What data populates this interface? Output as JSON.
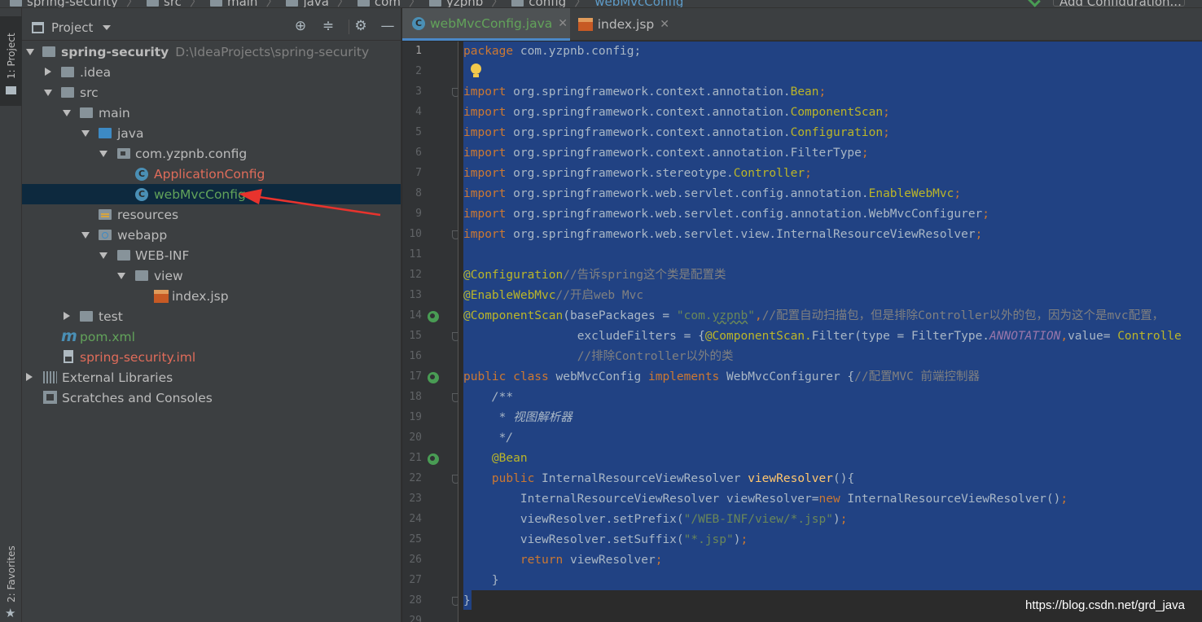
{
  "navbar": {
    "crumbs": [
      "spring-security",
      "src",
      "main",
      "java",
      "com",
      "yzpnb",
      "config"
    ],
    "current": "webMvcConfig",
    "run_config_label": "Add Configuration..."
  },
  "left_strip": {
    "project_label": "1: Project",
    "favorites_label": "2: Favorites"
  },
  "project_panel": {
    "title": "Project",
    "tree": [
      {
        "label": "spring-security",
        "path": "D:\\IdeaProjects\\spring-security"
      },
      {
        "label": ".idea"
      },
      {
        "label": "src"
      },
      {
        "label": "main"
      },
      {
        "label": "java"
      },
      {
        "label": "com.yzpnb.config"
      },
      {
        "label": "ApplicationConfig"
      },
      {
        "label": "webMvcConfig"
      },
      {
        "label": "resources"
      },
      {
        "label": "webapp"
      },
      {
        "label": "WEB-INF"
      },
      {
        "label": "view"
      },
      {
        "label": "index.jsp"
      },
      {
        "label": "test"
      },
      {
        "label": "pom.xml"
      },
      {
        "label": "spring-security.iml"
      },
      {
        "label": "External Libraries"
      },
      {
        "label": "Scratches and Consoles"
      }
    ]
  },
  "editor": {
    "tabs": [
      {
        "label": "webMvcConfig.java",
        "active": true
      },
      {
        "label": "index.jsp",
        "active": false
      }
    ],
    "line_numbers": [
      "1",
      "2",
      "3",
      "4",
      "5",
      "6",
      "7",
      "8",
      "9",
      "10",
      "11",
      "12",
      "13",
      "14",
      "15",
      "16",
      "17",
      "18",
      "19",
      "20",
      "21",
      "22",
      "23",
      "24",
      "25",
      "26",
      "27",
      "28",
      "29"
    ],
    "code": {
      "l1_kw": "package",
      "l1_rest": " com.yzpnb.config;",
      "l3_kw": "import",
      "l3_pkg": " org.springframework.context.annotation.",
      "l3_cls": "Bean",
      "l3_end": ";",
      "l4_kw": "import",
      "l4_pkg": " org.springframework.context.annotation.",
      "l4_cls": "ComponentScan",
      "l4_end": ";",
      "l5_kw": "import",
      "l5_pkg": " org.springframework.context.annotation.",
      "l5_cls": "Configuration",
      "l5_end": ";",
      "l6_kw": "import",
      "l6_pkg": " org.springframework.context.annotation.FilterType",
      "l6_end": ";",
      "l7_kw": "import",
      "l7_pkg": " org.springframework.stereotype.",
      "l7_cls": "Controller",
      "l7_end": ";",
      "l8_kw": "import",
      "l8_pkg": " org.springframework.web.servlet.config.annotation.",
      "l8_cls": "EnableWebMvc",
      "l8_end": ";",
      "l9_kw": "import",
      "l9_pkg": " org.springframework.web.servlet.config.annotation.WebMvcConfigurer",
      "l9_end": ";",
      "l10_kw": "import",
      "l10_pkg": " org.springframework.web.servlet.view.InternalResourceViewResolver",
      "l10_end": ";",
      "l12_ann": "@Configuration",
      "l12_cm": "//告诉spring这个类是配置类",
      "l13_ann": "@EnableWebMvc",
      "l13_cm": "//开启web Mvc",
      "l14_ann": "@ComponentScan",
      "l14_a": "(basePackages = ",
      "l14_s1": "\"com.",
      "l14_s2": "yzpnb",
      "l14_s3": "\"",
      "l14_comma": ",",
      "l14_cm": "//配置自动扫描包，但是排除Controller以外的包，因为这个是mvc配置，",
      "l15_pad": "                ",
      "l15_a": "excludeFilters = {",
      "l15_ann": "@ComponentScan.",
      "l15_b": "Filter(type = FilterType.",
      "l15_st": "ANNOTATION",
      "l15_comma": ",",
      "l15_c": "value= ",
      "l15_d": "Controlle",
      "l16_pad": "                ",
      "l16_cm": "//排除Controller以外的类",
      "l17_kw1": "public class",
      "l17_name": " webMvcConfig ",
      "l17_kw2": "implements",
      "l17_rest": " WebMvcConfigurer {",
      "l17_cm": "//配置MVC 前端控制器",
      "l18": "    /**",
      "l19": "     * 视图解析器",
      "l20": "     */",
      "l21_pad": "    ",
      "l21_ann": "@Bean",
      "l22_pad": "    ",
      "l22_kw": "public",
      "l22_type": " InternalResourceViewResolver ",
      "l22_fn": "viewResolver",
      "l22_rest": "(){",
      "l23_pad": "        ",
      "l23_a": "InternalResourceViewResolver viewResolver=",
      "l23_kw": "new",
      "l23_b": " InternalResourceViewResolver()",
      "l23_end": ";",
      "l24_pad": "        ",
      "l24_a": "viewResolver.setPrefix(",
      "l24_s": "\"/WEB-INF/view/*.jsp\"",
      "l24_b": ")",
      "l24_end": ";",
      "l25_pad": "        ",
      "l25_a": "viewResolver.setSuffix(",
      "l25_s": "\"*.jsp\"",
      "l25_b": ")",
      "l25_end": ";",
      "l26_pad": "        ",
      "l26_kw": "return",
      "l26_rest": " viewResolver",
      "l26_end": ";",
      "l27": "    }",
      "l28": "}"
    }
  },
  "watermark": "https://blog.csdn.net/grd_java",
  "colors": {
    "editor_bg": "#2b2b2b",
    "selection": "#214283",
    "keyword": "#cc7832",
    "annotation": "#bbb529",
    "string": "#6a8759",
    "comment": "#808080",
    "tree_selected": "#0d293e",
    "annotation_arrow": "#e8332d"
  }
}
